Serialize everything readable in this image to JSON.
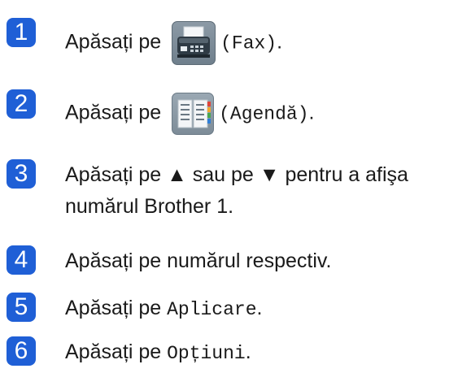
{
  "steps": [
    {
      "number": "1",
      "prefix": "Apăsați pe ",
      "code": "(Fax)",
      "icon": "fax-icon",
      "suffix": "."
    },
    {
      "number": "2",
      "prefix": "Apăsați pe ",
      "code": "(Agendă)",
      "icon": "address-book-icon",
      "suffix": "."
    },
    {
      "number": "3",
      "line1": "Apăsați pe ▲ sau pe ▼ pentru a afişa",
      "line2": "numărul Brother 1."
    },
    {
      "number": "4",
      "text": "Apăsați pe numărul respectiv."
    },
    {
      "number": "5",
      "prefix": "Apăsați pe ",
      "code": "Aplicare",
      "suffix": "."
    },
    {
      "number": "6",
      "prefix": "Apăsați pe ",
      "code": "Opțiuni",
      "suffix": "."
    }
  ],
  "colors": {
    "step_badge": "#1f5fd6",
    "text": "#1a1a1a"
  }
}
